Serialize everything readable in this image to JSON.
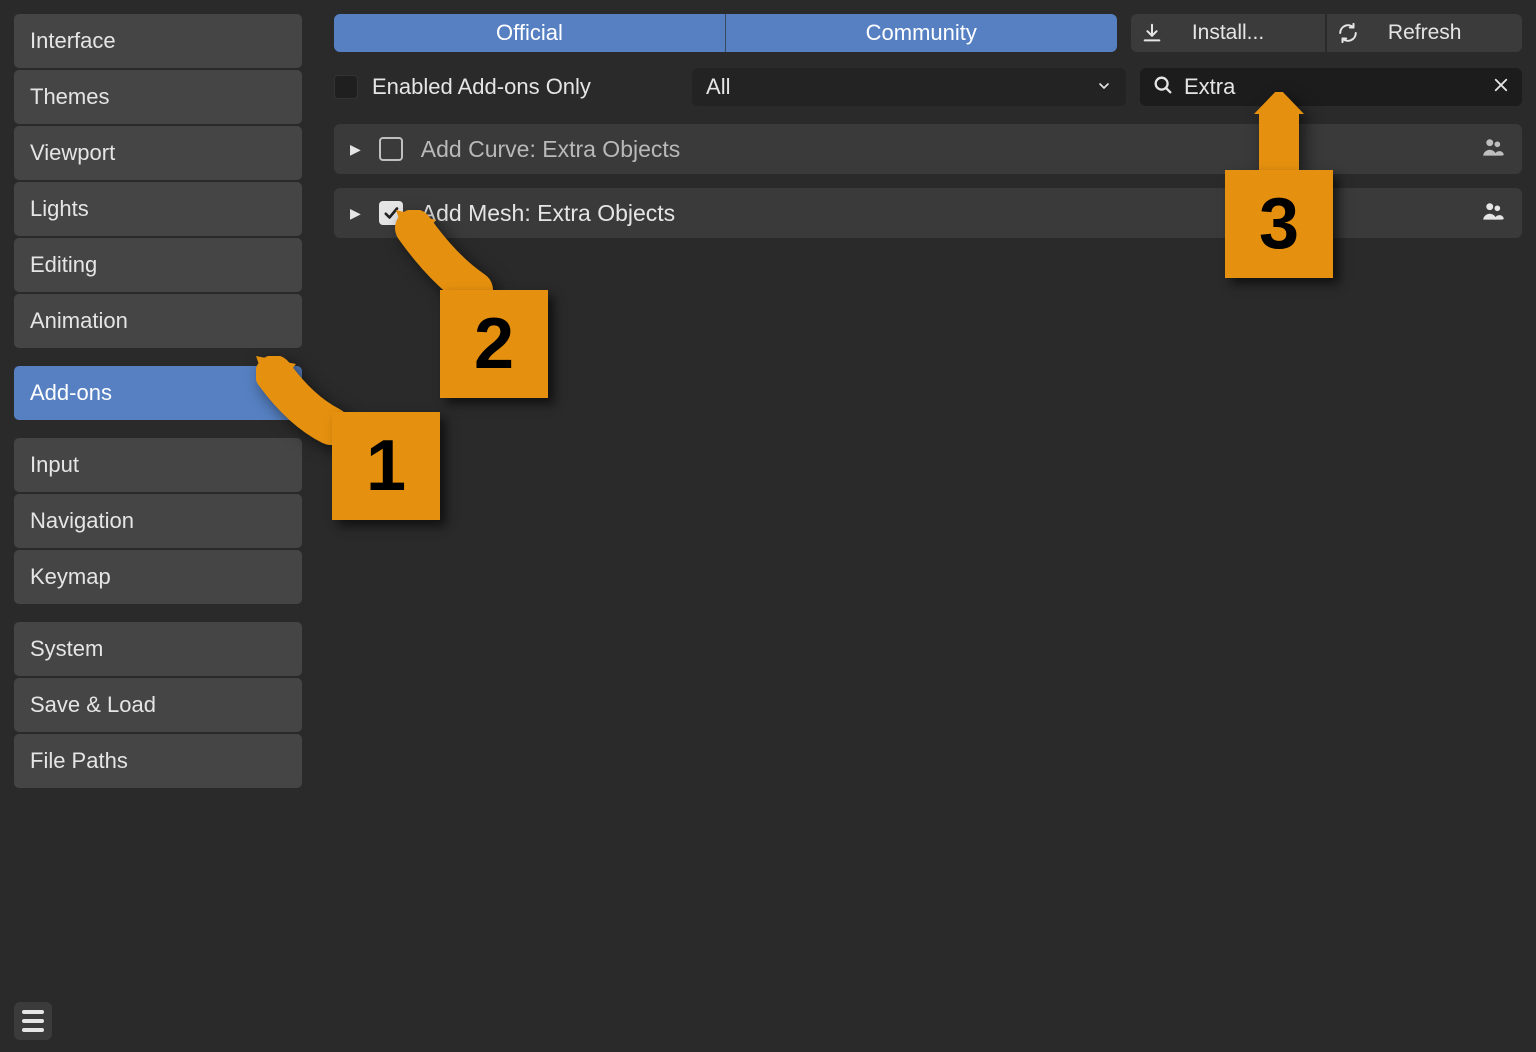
{
  "sidebar": {
    "groups": [
      {
        "items": [
          "Interface",
          "Themes",
          "Viewport",
          "Lights",
          "Editing",
          "Animation"
        ]
      },
      {
        "items": [
          "Add-ons"
        ],
        "activeIndex": 0
      },
      {
        "items": [
          "Input",
          "Navigation",
          "Keymap"
        ]
      },
      {
        "items": [
          "System",
          "Save & Load",
          "File Paths"
        ]
      }
    ]
  },
  "tabs": {
    "official": "Official",
    "community": "Community"
  },
  "buttons": {
    "install": "Install...",
    "refresh": "Refresh"
  },
  "filter": {
    "enabled_only_label": "Enabled Add-ons Only",
    "enabled_only_checked": false,
    "dropdown_value": "All",
    "search_value": "Extra"
  },
  "addons": [
    {
      "name": "Add Curve: Extra Objects",
      "enabled": false
    },
    {
      "name": "Add Mesh: Extra Objects",
      "enabled": true
    }
  ],
  "callouts": {
    "c1": "1",
    "c2": "2",
    "c3": "3"
  }
}
